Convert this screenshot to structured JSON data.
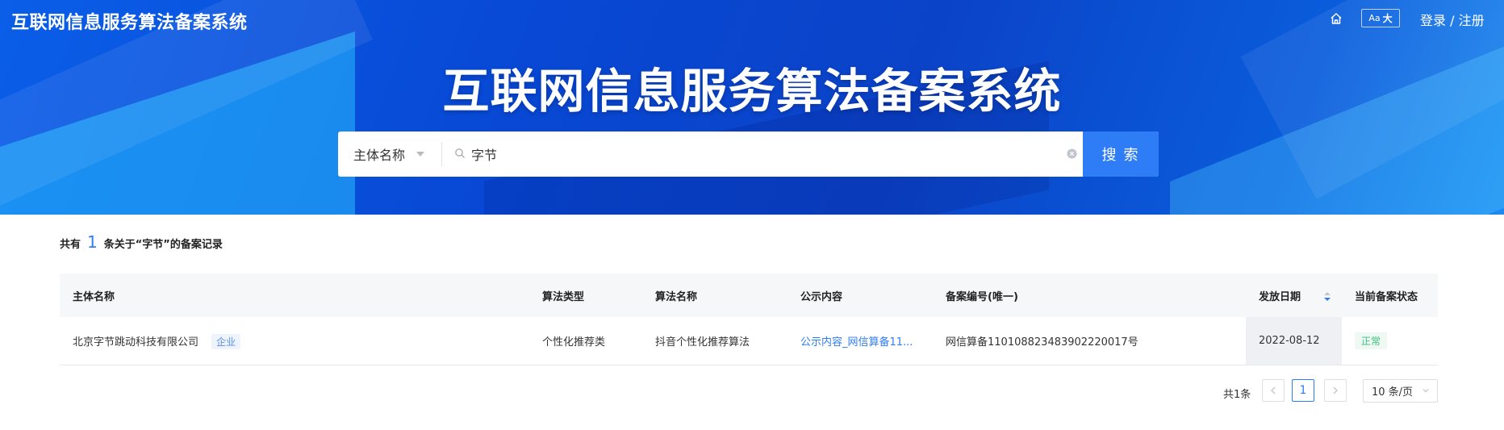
{
  "app": {
    "title": "互联网信息服务算法备案系统"
  },
  "header": {
    "font_toggle_small": "Aa",
    "font_toggle_large": "大",
    "login_label": "登录 / 注册"
  },
  "hero": {
    "title": "互联网信息服务算法备案系统"
  },
  "search": {
    "type_selected": "主体名称",
    "query": "字节",
    "button_label": "搜 索"
  },
  "summary": {
    "prefix": "共有",
    "count": "1",
    "suffix": "条关于“字节”的备案记录"
  },
  "table": {
    "columns": [
      "主体名称",
      "算法类型",
      "算法名称",
      "公示内容",
      "备案编号(唯一)",
      "发放日期",
      "当前备案状态"
    ],
    "rows": [
      {
        "entity": "北京字节跳动科技有限公司",
        "entity_tag": "企业",
        "algo_type": "个性化推荐类",
        "algo_name": "抖音个性化推荐算法",
        "disclosure": "公示内容_网信算备11...",
        "record_no": "网信算备110108823483902220017号",
        "issue_date": "2022-08-12",
        "status": "正常"
      }
    ]
  },
  "pagination": {
    "total": "共1条",
    "current_page": "1",
    "page_size": "10 条/页"
  },
  "colors": {
    "accent": "#2f7df6",
    "hero_blue": "#0a4fd6",
    "status_green": "#3fbf7f"
  }
}
